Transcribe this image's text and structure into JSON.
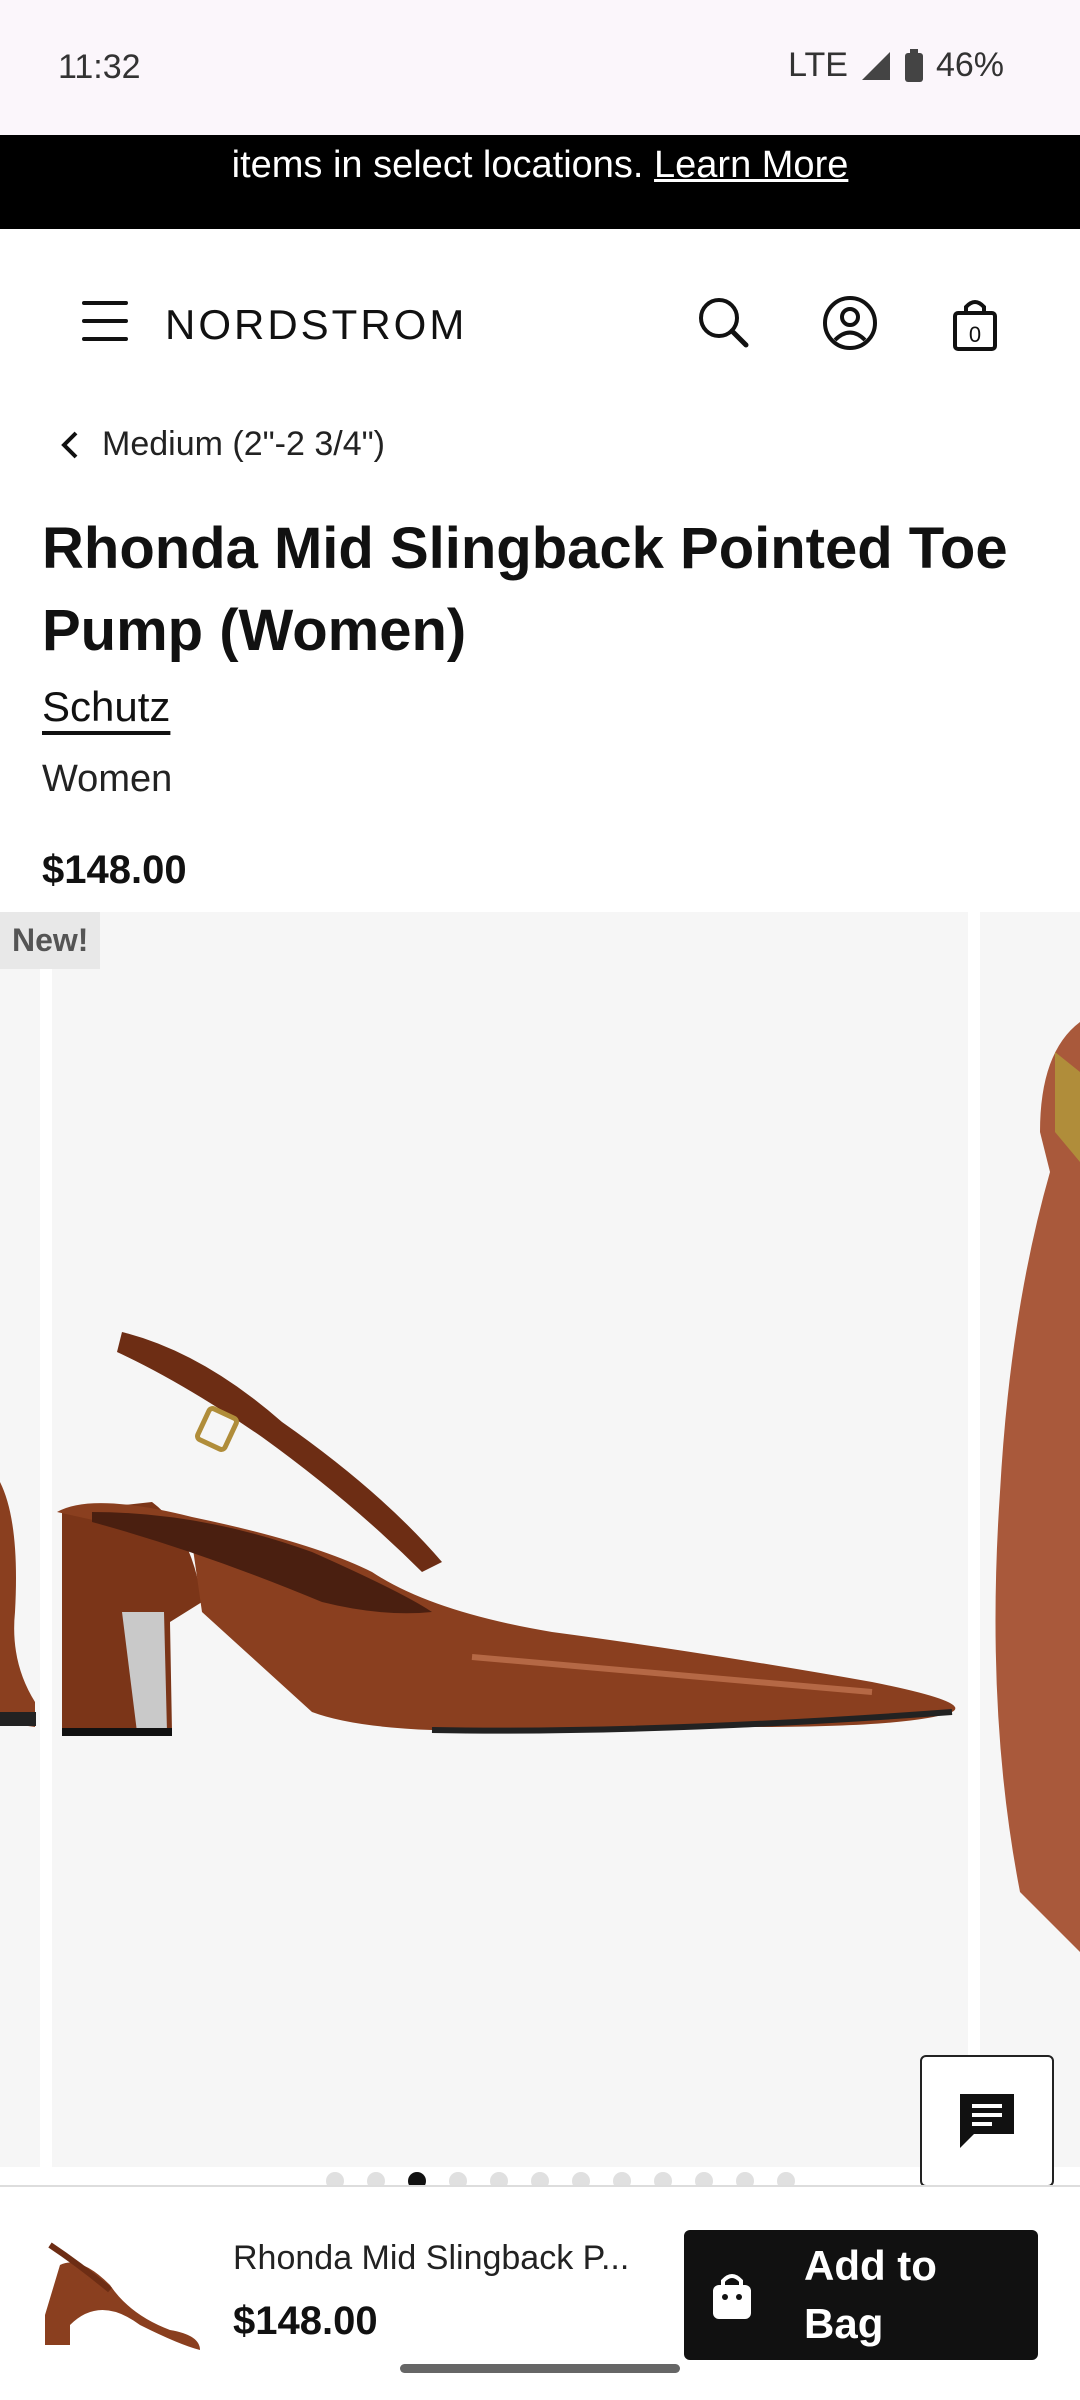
{
  "status_bar": {
    "time": "11:32",
    "network": "LTE",
    "battery": "46%"
  },
  "promo": {
    "text": "items in select locations.",
    "link": "Learn More"
  },
  "header": {
    "logo": "NORDSTROM",
    "bag_count": "0"
  },
  "breadcrumb": {
    "label": "Medium (2\"-2 3/4\")"
  },
  "product": {
    "title": "Rhonda Mid Slingback Pointed Toe Pump (Women)",
    "brand": "Schutz",
    "department": "Women",
    "price": "$148.00",
    "badge": "New!",
    "image_count": 12,
    "active_image_index": 3
  },
  "bottom_bar": {
    "name": "Rhonda Mid Slingback P...",
    "price": "$148.00",
    "add_label": "Add to Bag"
  },
  "colors": {
    "shoe": "#8a3f1f",
    "accent": "#000000"
  }
}
